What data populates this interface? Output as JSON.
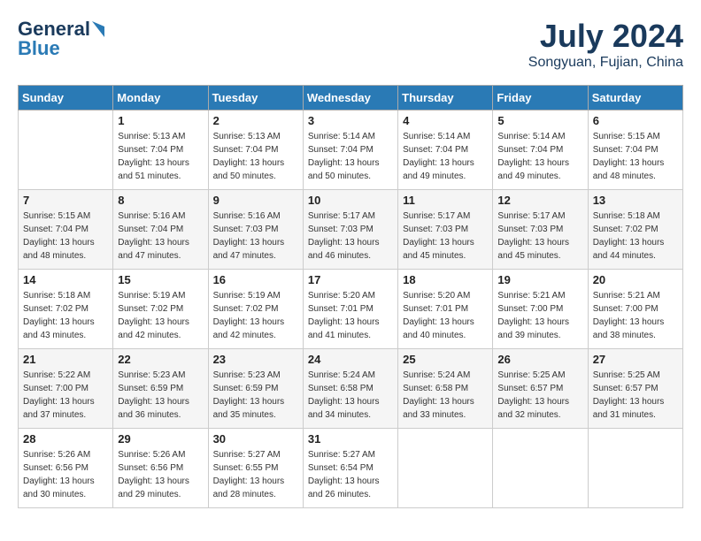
{
  "header": {
    "logo_general": "General",
    "logo_blue": "Blue",
    "month_title": "July 2024",
    "location": "Songyuan, Fujian, China"
  },
  "days_of_week": [
    "Sunday",
    "Monday",
    "Tuesday",
    "Wednesday",
    "Thursday",
    "Friday",
    "Saturday"
  ],
  "weeks": [
    [
      {
        "day": "",
        "sunrise": "",
        "sunset": "",
        "daylight": ""
      },
      {
        "day": "1",
        "sunrise": "Sunrise: 5:13 AM",
        "sunset": "Sunset: 7:04 PM",
        "daylight": "Daylight: 13 hours and 51 minutes."
      },
      {
        "day": "2",
        "sunrise": "Sunrise: 5:13 AM",
        "sunset": "Sunset: 7:04 PM",
        "daylight": "Daylight: 13 hours and 50 minutes."
      },
      {
        "day": "3",
        "sunrise": "Sunrise: 5:14 AM",
        "sunset": "Sunset: 7:04 PM",
        "daylight": "Daylight: 13 hours and 50 minutes."
      },
      {
        "day": "4",
        "sunrise": "Sunrise: 5:14 AM",
        "sunset": "Sunset: 7:04 PM",
        "daylight": "Daylight: 13 hours and 49 minutes."
      },
      {
        "day": "5",
        "sunrise": "Sunrise: 5:14 AM",
        "sunset": "Sunset: 7:04 PM",
        "daylight": "Daylight: 13 hours and 49 minutes."
      },
      {
        "day": "6",
        "sunrise": "Sunrise: 5:15 AM",
        "sunset": "Sunset: 7:04 PM",
        "daylight": "Daylight: 13 hours and 48 minutes."
      }
    ],
    [
      {
        "day": "7",
        "sunrise": "Sunrise: 5:15 AM",
        "sunset": "Sunset: 7:04 PM",
        "daylight": "Daylight: 13 hours and 48 minutes."
      },
      {
        "day": "8",
        "sunrise": "Sunrise: 5:16 AM",
        "sunset": "Sunset: 7:04 PM",
        "daylight": "Daylight: 13 hours and 47 minutes."
      },
      {
        "day": "9",
        "sunrise": "Sunrise: 5:16 AM",
        "sunset": "Sunset: 7:03 PM",
        "daylight": "Daylight: 13 hours and 47 minutes."
      },
      {
        "day": "10",
        "sunrise": "Sunrise: 5:17 AM",
        "sunset": "Sunset: 7:03 PM",
        "daylight": "Daylight: 13 hours and 46 minutes."
      },
      {
        "day": "11",
        "sunrise": "Sunrise: 5:17 AM",
        "sunset": "Sunset: 7:03 PM",
        "daylight": "Daylight: 13 hours and 45 minutes."
      },
      {
        "day": "12",
        "sunrise": "Sunrise: 5:17 AM",
        "sunset": "Sunset: 7:03 PM",
        "daylight": "Daylight: 13 hours and 45 minutes."
      },
      {
        "day": "13",
        "sunrise": "Sunrise: 5:18 AM",
        "sunset": "Sunset: 7:02 PM",
        "daylight": "Daylight: 13 hours and 44 minutes."
      }
    ],
    [
      {
        "day": "14",
        "sunrise": "Sunrise: 5:18 AM",
        "sunset": "Sunset: 7:02 PM",
        "daylight": "Daylight: 13 hours and 43 minutes."
      },
      {
        "day": "15",
        "sunrise": "Sunrise: 5:19 AM",
        "sunset": "Sunset: 7:02 PM",
        "daylight": "Daylight: 13 hours and 42 minutes."
      },
      {
        "day": "16",
        "sunrise": "Sunrise: 5:19 AM",
        "sunset": "Sunset: 7:02 PM",
        "daylight": "Daylight: 13 hours and 42 minutes."
      },
      {
        "day": "17",
        "sunrise": "Sunrise: 5:20 AM",
        "sunset": "Sunset: 7:01 PM",
        "daylight": "Daylight: 13 hours and 41 minutes."
      },
      {
        "day": "18",
        "sunrise": "Sunrise: 5:20 AM",
        "sunset": "Sunset: 7:01 PM",
        "daylight": "Daylight: 13 hours and 40 minutes."
      },
      {
        "day": "19",
        "sunrise": "Sunrise: 5:21 AM",
        "sunset": "Sunset: 7:00 PM",
        "daylight": "Daylight: 13 hours and 39 minutes."
      },
      {
        "day": "20",
        "sunrise": "Sunrise: 5:21 AM",
        "sunset": "Sunset: 7:00 PM",
        "daylight": "Daylight: 13 hours and 38 minutes."
      }
    ],
    [
      {
        "day": "21",
        "sunrise": "Sunrise: 5:22 AM",
        "sunset": "Sunset: 7:00 PM",
        "daylight": "Daylight: 13 hours and 37 minutes."
      },
      {
        "day": "22",
        "sunrise": "Sunrise: 5:23 AM",
        "sunset": "Sunset: 6:59 PM",
        "daylight": "Daylight: 13 hours and 36 minutes."
      },
      {
        "day": "23",
        "sunrise": "Sunrise: 5:23 AM",
        "sunset": "Sunset: 6:59 PM",
        "daylight": "Daylight: 13 hours and 35 minutes."
      },
      {
        "day": "24",
        "sunrise": "Sunrise: 5:24 AM",
        "sunset": "Sunset: 6:58 PM",
        "daylight": "Daylight: 13 hours and 34 minutes."
      },
      {
        "day": "25",
        "sunrise": "Sunrise: 5:24 AM",
        "sunset": "Sunset: 6:58 PM",
        "daylight": "Daylight: 13 hours and 33 minutes."
      },
      {
        "day": "26",
        "sunrise": "Sunrise: 5:25 AM",
        "sunset": "Sunset: 6:57 PM",
        "daylight": "Daylight: 13 hours and 32 minutes."
      },
      {
        "day": "27",
        "sunrise": "Sunrise: 5:25 AM",
        "sunset": "Sunset: 6:57 PM",
        "daylight": "Daylight: 13 hours and 31 minutes."
      }
    ],
    [
      {
        "day": "28",
        "sunrise": "Sunrise: 5:26 AM",
        "sunset": "Sunset: 6:56 PM",
        "daylight": "Daylight: 13 hours and 30 minutes."
      },
      {
        "day": "29",
        "sunrise": "Sunrise: 5:26 AM",
        "sunset": "Sunset: 6:56 PM",
        "daylight": "Daylight: 13 hours and 29 minutes."
      },
      {
        "day": "30",
        "sunrise": "Sunrise: 5:27 AM",
        "sunset": "Sunset: 6:55 PM",
        "daylight": "Daylight: 13 hours and 28 minutes."
      },
      {
        "day": "31",
        "sunrise": "Sunrise: 5:27 AM",
        "sunset": "Sunset: 6:54 PM",
        "daylight": "Daylight: 13 hours and 26 minutes."
      },
      {
        "day": "",
        "sunrise": "",
        "sunset": "",
        "daylight": ""
      },
      {
        "day": "",
        "sunrise": "",
        "sunset": "",
        "daylight": ""
      },
      {
        "day": "",
        "sunrise": "",
        "sunset": "",
        "daylight": ""
      }
    ]
  ]
}
